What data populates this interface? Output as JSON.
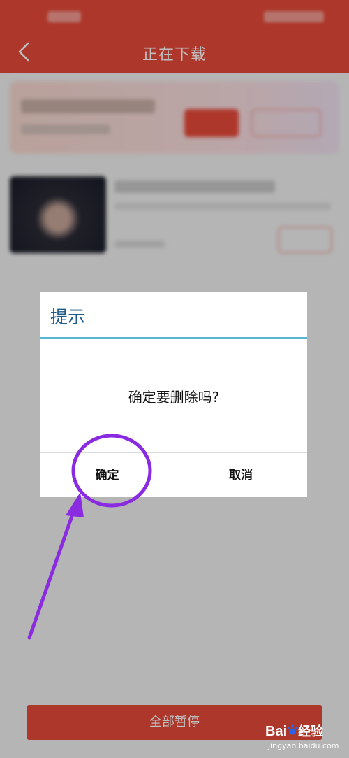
{
  "header": {
    "title": "正在下载"
  },
  "dialog": {
    "title": "提示",
    "message": "确定要删除吗?",
    "confirm_label": "确定",
    "cancel_label": "取消"
  },
  "footer": {
    "pause_all_label": "全部暂停"
  },
  "watermark": {
    "brand": "Bai",
    "brand_tail": "经验",
    "url": "jingyan.baidu.com"
  },
  "colors": {
    "accent": "#e94a3a",
    "dialog_title": "#1e5a8a",
    "dialog_divider": "#57b5d5",
    "annotation": "#8a2be2"
  }
}
